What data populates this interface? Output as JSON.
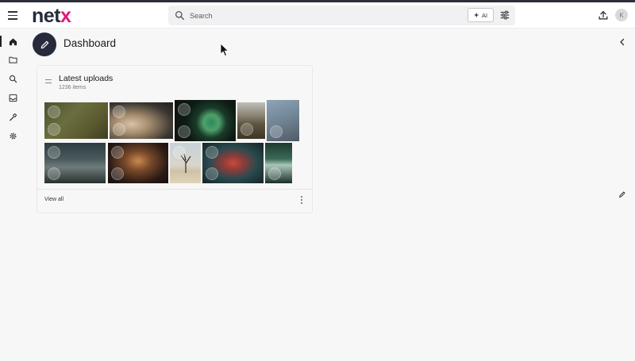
{
  "app": {
    "logo_main": "net",
    "logo_accent": "x"
  },
  "header": {
    "search_placeholder": "Search",
    "ai_label": "AI",
    "avatar_initial": "K"
  },
  "sidebar": {
    "items": [
      {
        "icon": "home-icon",
        "active": true
      },
      {
        "icon": "folder-icon"
      },
      {
        "icon": "search-icon"
      },
      {
        "icon": "inbox-icon"
      },
      {
        "icon": "tools-icon"
      },
      {
        "icon": "gear-icon"
      }
    ]
  },
  "page": {
    "title": "Dashboard"
  },
  "widget": {
    "title": "Latest uploads",
    "count": "1236 items",
    "view_all": "View all",
    "thumbnails_row1": [
      "pixabay-texture",
      "fox-pups",
      "chameleon-tail",
      "mountain-landscape",
      "gorilla-hand"
    ],
    "thumbnails_row2": [
      "misty-forest",
      "night-alley",
      "dead-tree-desert",
      "iguana",
      "arowana-fish"
    ]
  },
  "colors": {
    "brand_dark": "#262a3a",
    "brand_accent": "#e4167b",
    "background": "#f7f7f7"
  }
}
